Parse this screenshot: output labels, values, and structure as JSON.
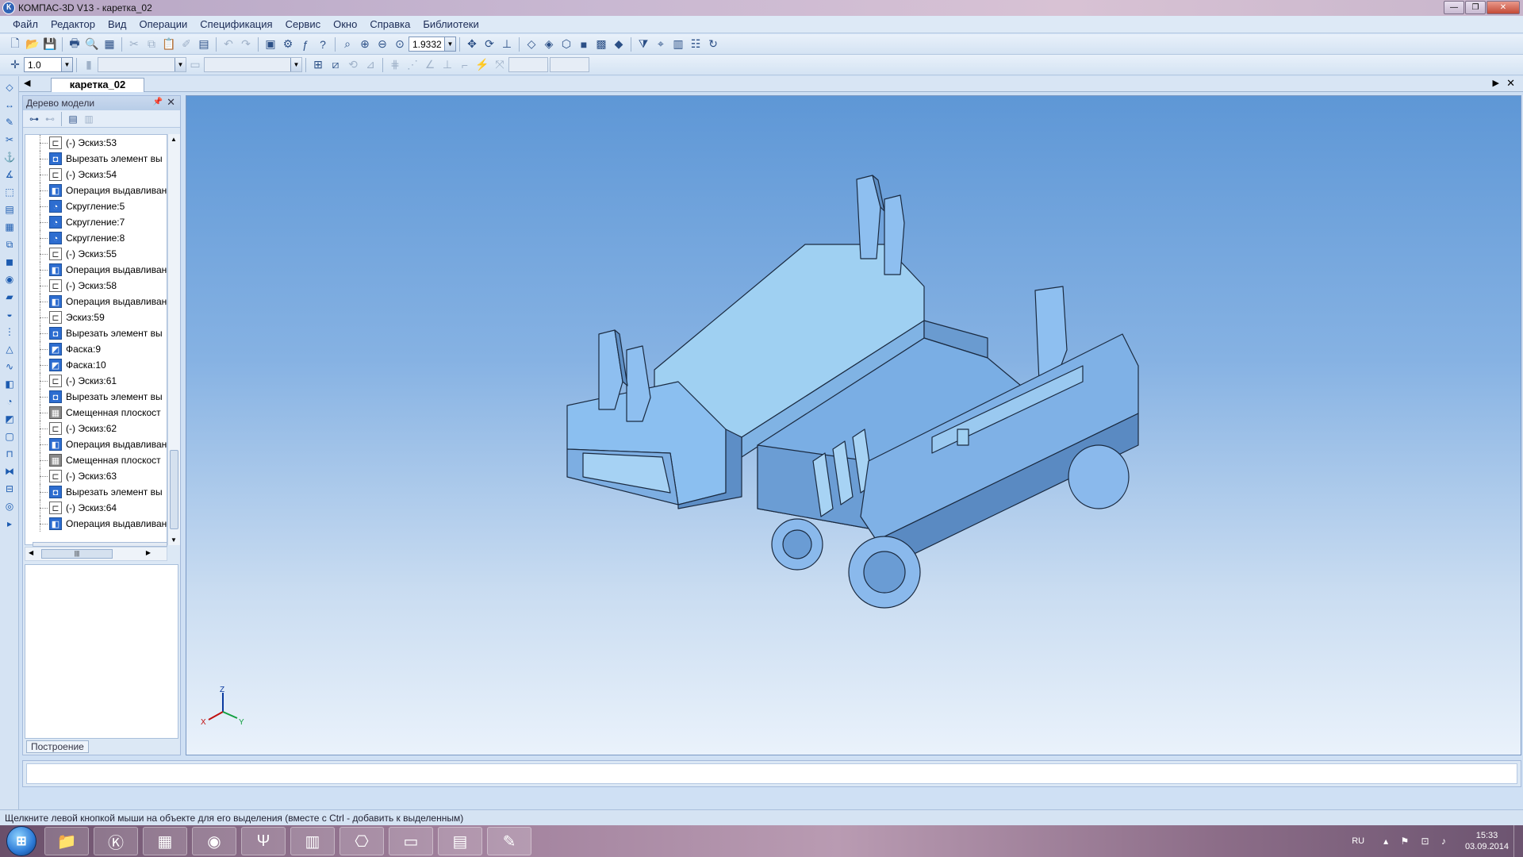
{
  "window": {
    "title": "КОМПАС-3D V13 - каретка_02",
    "icon": "kompas-icon"
  },
  "menu": [
    "Файл",
    "Редактор",
    "Вид",
    "Операции",
    "Спецификация",
    "Сервис",
    "Окно",
    "Справка",
    "Библиотеки"
  ],
  "toolbar1": {
    "zoom_value": "1.9332"
  },
  "toolbar2": {
    "step_value": "1.0",
    "layer_value": "",
    "style_value": "",
    "coord_x": "",
    "coord_y": ""
  },
  "document_tab": {
    "label": "каретка_02"
  },
  "tree_panel": {
    "title": "Дерево модели",
    "items": [
      {
        "label": "(-) Эскиз:53",
        "icon": "sketch-icon"
      },
      {
        "label": "Вырезать элемент вы",
        "icon": "cut-extrude-icon"
      },
      {
        "label": "(-) Эскиз:54",
        "icon": "sketch-icon"
      },
      {
        "label": "Операция выдавливан",
        "icon": "extrude-icon"
      },
      {
        "label": "Скругление:5",
        "icon": "fillet-icon"
      },
      {
        "label": "Скругление:7",
        "icon": "fillet-icon"
      },
      {
        "label": "Скругление:8",
        "icon": "fillet-icon"
      },
      {
        "label": "(-) Эскиз:55",
        "icon": "sketch-icon"
      },
      {
        "label": "Операция выдавливан",
        "icon": "extrude-icon"
      },
      {
        "label": "(-) Эскиз:58",
        "icon": "sketch-icon"
      },
      {
        "label": "Операция выдавливан",
        "icon": "extrude-icon"
      },
      {
        "label": "Эскиз:59",
        "icon": "sketch-icon"
      },
      {
        "label": "Вырезать элемент вы",
        "icon": "cut-extrude-icon"
      },
      {
        "label": "Фаска:9",
        "icon": "chamfer-icon"
      },
      {
        "label": "Фаска:10",
        "icon": "chamfer-icon"
      },
      {
        "label": "(-) Эскиз:61",
        "icon": "sketch-icon"
      },
      {
        "label": "Вырезать элемент вы",
        "icon": "cut-extrude-icon"
      },
      {
        "label": "Смещенная плоскост",
        "icon": "offset-plane-icon"
      },
      {
        "label": "(-) Эскиз:62",
        "icon": "sketch-icon"
      },
      {
        "label": "Операция выдавливан",
        "icon": "extrude-icon"
      },
      {
        "label": "Смещенная плоскост",
        "icon": "offset-plane-icon"
      },
      {
        "label": "(-) Эскиз:63",
        "icon": "sketch-icon"
      },
      {
        "label": "Вырезать элемент вы",
        "icon": "cut-extrude-icon"
      },
      {
        "label": "(-) Эскиз:64",
        "icon": "sketch-icon"
      },
      {
        "label": "Операция выдавливан",
        "icon": "extrude-icon"
      }
    ],
    "bottom_tab": "Построение"
  },
  "viewport": {
    "axes": {
      "x": "X",
      "y": "Y",
      "z": "Z"
    }
  },
  "statusbar": {
    "text": "Щелкните левой кнопкой мыши на объекте для его выделения (вместе с Ctrl - добавить к выделенным)"
  },
  "taskbar": {
    "apps": [
      "explorer-icon",
      "kompas-icon",
      "calculator-icon",
      "firefox-icon",
      "mathcad-icon",
      "books-icon",
      "acrobat-icon",
      "screenshot-icon",
      "clipboard-icon",
      "paint-icon"
    ],
    "language": "RU",
    "time": "15:33",
    "date": "03.09.2014"
  }
}
